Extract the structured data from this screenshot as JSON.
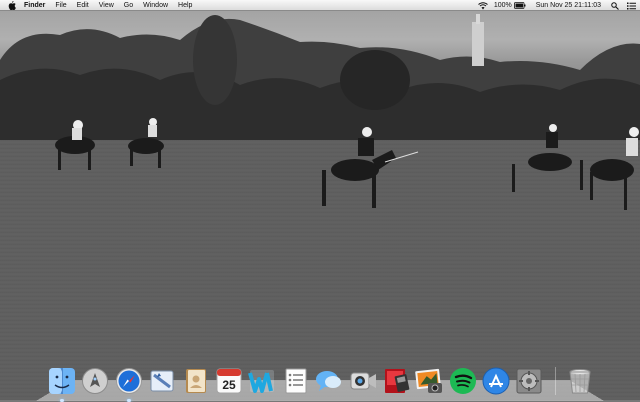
{
  "menubar": {
    "apple_icon": "apple-icon",
    "items": [
      {
        "label": "Finder",
        "bold": true
      },
      {
        "label": "File"
      },
      {
        "label": "Edit"
      },
      {
        "label": "View"
      },
      {
        "label": "Go"
      },
      {
        "label": "Window"
      },
      {
        "label": "Help"
      }
    ],
    "status": {
      "battery": "100%",
      "clock": "Sun Nov 25  21:11:03"
    }
  },
  "dock": {
    "apps": [
      {
        "name": "finder-icon",
        "running": true
      },
      {
        "name": "launchpad-icon",
        "running": false
      },
      {
        "name": "safari-icon",
        "running": true
      },
      {
        "name": "mail-icon",
        "running": false
      },
      {
        "name": "contacts-icon",
        "running": false
      },
      {
        "name": "calendar-icon",
        "running": false,
        "label": "25"
      },
      {
        "name": "word-icon",
        "running": false
      },
      {
        "name": "reminders-icon",
        "running": false
      },
      {
        "name": "messages-icon",
        "running": false
      },
      {
        "name": "facetime-icon",
        "running": false
      },
      {
        "name": "photo-booth-icon",
        "running": false
      },
      {
        "name": "iphoto-icon",
        "running": false
      },
      {
        "name": "spotify-icon",
        "running": false
      },
      {
        "name": "app-store-icon",
        "running": false
      },
      {
        "name": "system-preferences-icon",
        "running": false
      }
    ],
    "trash": {
      "name": "trash-icon"
    }
  },
  "colors": {
    "menubar": "#e8e8e8",
    "spotify": "#1db954",
    "safari": "#1e6fd9"
  }
}
